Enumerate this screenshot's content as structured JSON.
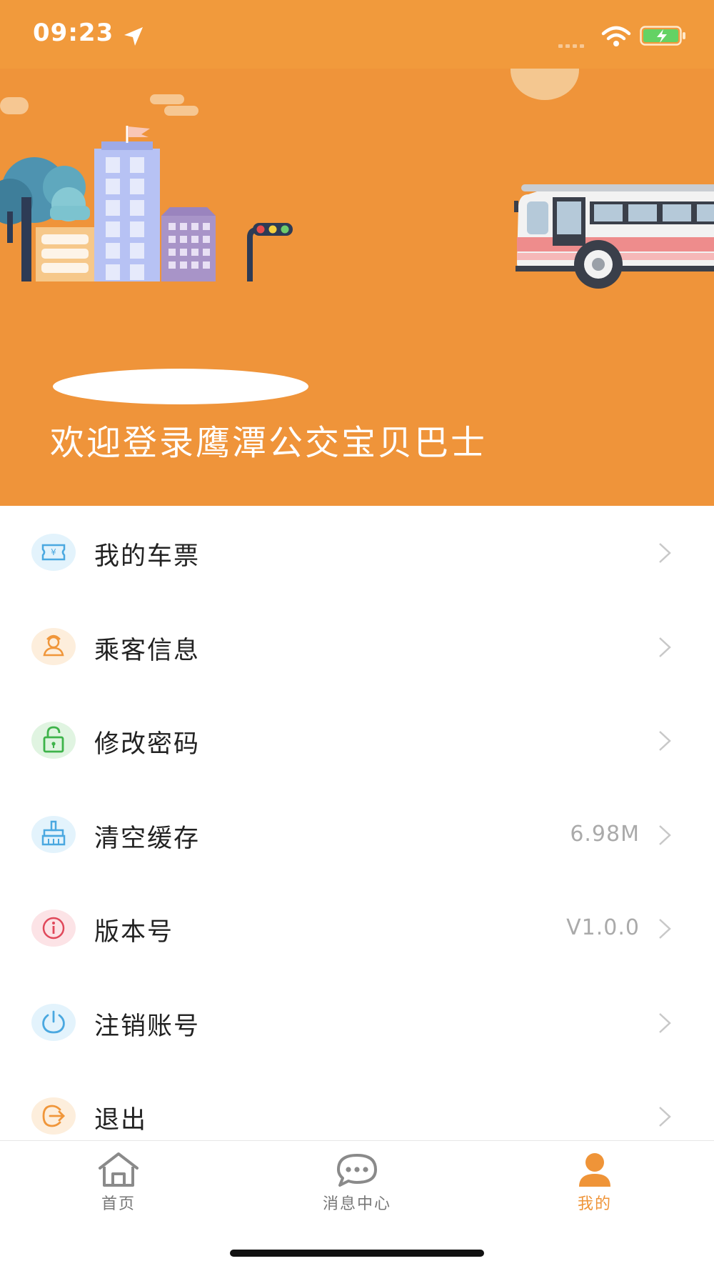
{
  "status_bar": {
    "time": "09:23"
  },
  "hero": {
    "welcome_text": "欢迎登录鹰潭公交宝贝巴士"
  },
  "menu": {
    "items": [
      {
        "label": "我的车票",
        "value": "",
        "icon": "ticket-icon",
        "icon_color": "#4AA8E0",
        "icon_bg": "#E3F3FC"
      },
      {
        "label": "乘客信息",
        "value": "",
        "icon": "passenger-icon",
        "icon_color": "#F0963A",
        "icon_bg": "#FDEEDC"
      },
      {
        "label": "修改密码",
        "value": "",
        "icon": "unlock-icon",
        "icon_color": "#3EB34A",
        "icon_bg": "#E0F4E1"
      },
      {
        "label": "清空缓存",
        "value": "6.98M",
        "icon": "broom-icon",
        "icon_color": "#4AA8E0",
        "icon_bg": "#E3F3FC"
      },
      {
        "label": "版本号",
        "value": "V1.0.0",
        "icon": "info-icon",
        "icon_color": "#E0485A",
        "icon_bg": "#FCE3E6"
      },
      {
        "label": "注销账号",
        "value": "",
        "icon": "power-icon",
        "icon_color": "#4AA8E0",
        "icon_bg": "#E3F3FC"
      },
      {
        "label": "退出",
        "value": "",
        "icon": "logout-icon",
        "icon_color": "#F0963A",
        "icon_bg": "#FDEEDC"
      }
    ]
  },
  "tab_bar": {
    "tabs": [
      {
        "label": "首页",
        "icon": "home-icon",
        "active": false
      },
      {
        "label": "消息中心",
        "icon": "chat-icon",
        "active": false
      },
      {
        "label": "我的",
        "icon": "user-icon",
        "active": true
      }
    ]
  },
  "colors": {
    "accent": "#EF9438",
    "hero_bg": "#EF943A",
    "status_bg": "#F19A3C"
  }
}
